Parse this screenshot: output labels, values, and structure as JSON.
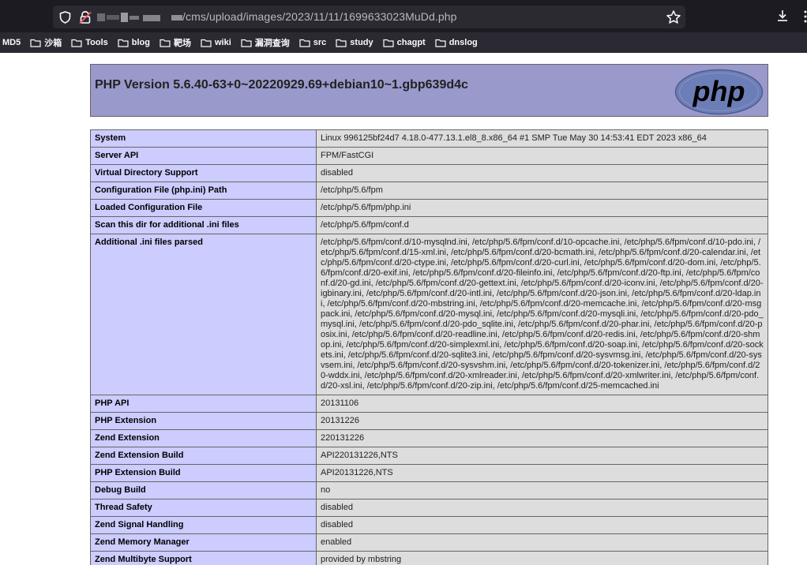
{
  "browser": {
    "url_path": "/cms/upload/images/2023/11/11/1699633023MuDd.php",
    "bookmarks": [
      "MD5",
      "沙箱",
      "Tools",
      "blog",
      "靶场",
      "wiki",
      "漏洞查询",
      "src",
      "study",
      "chagpt",
      "dnslog"
    ]
  },
  "phpinfo": {
    "version_title": "PHP Version 5.6.40-63+0~20220929.69+debian10~1.gbp639d4c",
    "logo_text": "php",
    "rows": [
      {
        "key": "System",
        "value": "Linux 996125bf24d7 4.18.0-477.13.1.el8_8.x86_64 #1 SMP Tue May 30 14:53:41 EDT 2023 x86_64"
      },
      {
        "key": "Server API",
        "value": "FPM/FastCGI"
      },
      {
        "key": "Virtual Directory Support",
        "value": "disabled"
      },
      {
        "key": "Configuration File (php.ini) Path",
        "value": "/etc/php/5.6/fpm"
      },
      {
        "key": "Loaded Configuration File",
        "value": "/etc/php/5.6/fpm/php.ini"
      },
      {
        "key": "Scan this dir for additional .ini files",
        "value": "/etc/php/5.6/fpm/conf.d"
      },
      {
        "key": "Additional .ini files parsed",
        "value": "/etc/php/5.6/fpm/conf.d/10-mysqlnd.ini, /etc/php/5.6/fpm/conf.d/10-opcache.ini, /etc/php/5.6/fpm/conf.d/10-pdo.ini, /etc/php/5.6/fpm/conf.d/15-xml.ini, /etc/php/5.6/fpm/conf.d/20-bcmath.ini, /etc/php/5.6/fpm/conf.d/20-calendar.ini, /etc/php/5.6/fpm/conf.d/20-ctype.ini, /etc/php/5.6/fpm/conf.d/20-curl.ini, /etc/php/5.6/fpm/conf.d/20-dom.ini, /etc/php/5.6/fpm/conf.d/20-exif.ini, /etc/php/5.6/fpm/conf.d/20-fileinfo.ini, /etc/php/5.6/fpm/conf.d/20-ftp.ini, /etc/php/5.6/fpm/conf.d/20-gd.ini, /etc/php/5.6/fpm/conf.d/20-gettext.ini, /etc/php/5.6/fpm/conf.d/20-iconv.ini, /etc/php/5.6/fpm/conf.d/20-igbinary.ini, /etc/php/5.6/fpm/conf.d/20-intl.ini, /etc/php/5.6/fpm/conf.d/20-json.ini, /etc/php/5.6/fpm/conf.d/20-ldap.ini, /etc/php/5.6/fpm/conf.d/20-mbstring.ini, /etc/php/5.6/fpm/conf.d/20-memcache.ini, /etc/php/5.6/fpm/conf.d/20-msgpack.ini, /etc/php/5.6/fpm/conf.d/20-mysql.ini, /etc/php/5.6/fpm/conf.d/20-mysqli.ini, /etc/php/5.6/fpm/conf.d/20-pdo_mysql.ini, /etc/php/5.6/fpm/conf.d/20-pdo_sqlite.ini, /etc/php/5.6/fpm/conf.d/20-phar.ini, /etc/php/5.6/fpm/conf.d/20-posix.ini, /etc/php/5.6/fpm/conf.d/20-readline.ini, /etc/php/5.6/fpm/conf.d/20-redis.ini, /etc/php/5.6/fpm/conf.d/20-shmop.ini, /etc/php/5.6/fpm/conf.d/20-simplexml.ini, /etc/php/5.6/fpm/conf.d/20-soap.ini, /etc/php/5.6/fpm/conf.d/20-sockets.ini, /etc/php/5.6/fpm/conf.d/20-sqlite3.ini, /etc/php/5.6/fpm/conf.d/20-sysvmsg.ini, /etc/php/5.6/fpm/conf.d/20-sysvsem.ini, /etc/php/5.6/fpm/conf.d/20-sysvshm.ini, /etc/php/5.6/fpm/conf.d/20-tokenizer.ini, /etc/php/5.6/fpm/conf.d/20-wddx.ini, /etc/php/5.6/fpm/conf.d/20-xmlreader.ini, /etc/php/5.6/fpm/conf.d/20-xmlwriter.ini, /etc/php/5.6/fpm/conf.d/20-xsl.ini, /etc/php/5.6/fpm/conf.d/20-zip.ini, /etc/php/5.6/fpm/conf.d/25-memcached.ini"
      },
      {
        "key": "PHP API",
        "value": "20131106"
      },
      {
        "key": "PHP Extension",
        "value": "20131226"
      },
      {
        "key": "Zend Extension",
        "value": "220131226"
      },
      {
        "key": "Zend Extension Build",
        "value": "API220131226,NTS"
      },
      {
        "key": "PHP Extension Build",
        "value": "API20131226,NTS"
      },
      {
        "key": "Debug Build",
        "value": "no"
      },
      {
        "key": "Thread Safety",
        "value": "disabled"
      },
      {
        "key": "Zend Signal Handling",
        "value": "disabled"
      },
      {
        "key": "Zend Memory Manager",
        "value": "enabled"
      },
      {
        "key": "Zend Multibyte Support",
        "value": "provided by mbstring"
      }
    ]
  },
  "colors": {
    "header_bg": "#9999cc",
    "key_bg": "#ccccff",
    "value_bg": "#dddddd",
    "chrome_dark": "#1c1b22",
    "toolbar": "#2b2a33"
  }
}
